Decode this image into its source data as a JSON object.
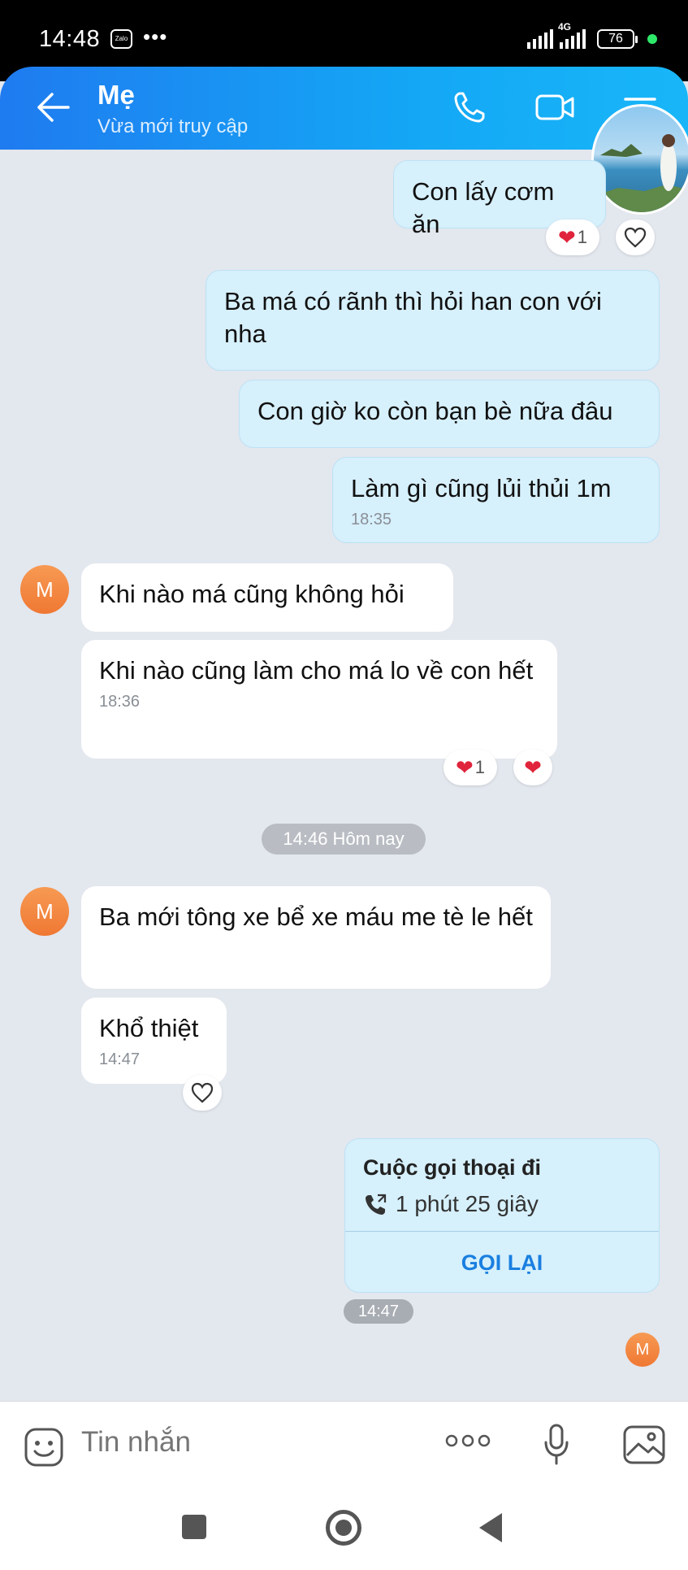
{
  "status_bar": {
    "time": "14:48",
    "app_badge": "Zalo",
    "more": "•••",
    "network": "4G",
    "battery": "76"
  },
  "header": {
    "title": "Mẹ",
    "subtitle": "Vừa mới truy cập",
    "accent_color": "#1a8cf2"
  },
  "messages": [
    {
      "from": "me",
      "text": "Con lấy cơm ăn",
      "reaction_count": "1"
    },
    {
      "from": "me",
      "text": "Ba má có rãnh thì hỏi han con với nha"
    },
    {
      "from": "me",
      "text": "Con giờ ko còn bạn bè nữa đâu"
    },
    {
      "from": "me",
      "text": "Làm gì cũng lủi thủi 1m",
      "time": "18:35"
    },
    {
      "from": "mom",
      "avatar": "M",
      "text": "Khi nào má cũng không hỏi"
    },
    {
      "from": "mom",
      "text": "Khi nào cũng làm cho má lo về con hết",
      "time": "18:36",
      "reaction_count": "1"
    },
    {
      "from": "mom",
      "avatar": "M",
      "text": "Ba mới tông xe bể xe máu me tè le hết"
    },
    {
      "from": "mom",
      "text": "Khổ thiệt",
      "time": "14:47"
    }
  ],
  "date_divider": "14:46 Hôm nay",
  "call_card": {
    "title": "Cuộc gọi thoại đi",
    "duration": "1 phút 25 giây",
    "action": "GỌI LẠI",
    "time": "14:47"
  },
  "seen_avatar": "M",
  "input": {
    "placeholder": "Tin nhắn"
  },
  "icons": [
    "back-arrow-icon",
    "phone-icon",
    "video-camera-icon",
    "menu-icon",
    "heart-icon",
    "emoji-icon",
    "more-icon",
    "microphone-icon",
    "image-icon"
  ]
}
